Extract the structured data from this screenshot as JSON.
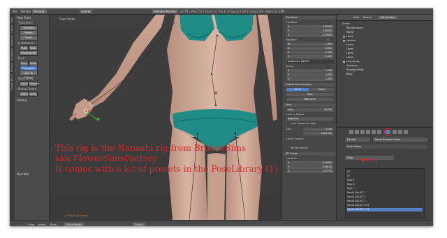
{
  "topbar": {
    "menu_items": [
      "File",
      "Render",
      "Window",
      "Help"
    ],
    "layout": "Default",
    "scene": "Scene",
    "engine": "Blender Render",
    "stats": "v2.78 | Verts:59 | Faces:0 | Tris:0 | Objects:1/42 | Lamps:0/0 | Mem:53.19M"
  },
  "left_tools": {
    "tabs": [
      "Tools",
      "Create",
      "Relations",
      "Animation",
      "Physics",
      "Grease Pencil"
    ],
    "section_pose_tools": "Pose Tools",
    "transform_label": "Transform:",
    "translate": "Translate",
    "rotate": "Rotate",
    "scale": "Scale",
    "in_between_label": "In-Between:",
    "push": "Push",
    "relax": "Relax",
    "breakdowner": "Breakdowner",
    "pose_label": "Pose:",
    "copy": "Copy",
    "paste": "Paste",
    "propagate": "Propagate",
    "add_to_library": "Add To Library",
    "keyframes_label": "Keyframes:",
    "insert": "Insert",
    "remove": "Remove",
    "motion_paths_label": "Motion Paths:",
    "calculate": "Calculate",
    "clear": "Clear",
    "history": "History",
    "operator": "Operator"
  },
  "viewport": {
    "label": "Front Ortho",
    "status": "(0) rig : b_R_Hand_"
  },
  "properties": {
    "transform_header": "Transform",
    "location_label": "Location:",
    "location": [
      {
        "k": "X:",
        "v": "0.00000"
      },
      {
        "k": "Y:",
        "v": "0.00000"
      },
      {
        "k": "Z:",
        "v": "0.00000"
      }
    ],
    "rotation_label": "Rotation:",
    "rotation_mode": "4L",
    "rotation": [
      {
        "k": "W:",
        "v": "1.000"
      },
      {
        "k": "X:",
        "v": "0.000"
      },
      {
        "k": "Y:",
        "v": "0.000"
      },
      {
        "k": "Z:",
        "v": "0.000"
      }
    ],
    "rotation_mode_select": "Quaternion (WXYZ)",
    "scale_label": "Scale:",
    "scale": [
      {
        "k": "X:",
        "v": "1.000"
      },
      {
        "k": "Y:",
        "v": "1.000"
      },
      {
        "k": "Z:",
        "v": "1.000"
      }
    ],
    "grease_pencil_header": "Grease Pencil Layers",
    "scene_btn": "Scene",
    "object_btn": "Object",
    "new_btn": "New",
    "new_layer_btn": "New Layer",
    "view_header": "View",
    "lens_label": "Lens:",
    "lens_value": "35.000",
    "lock_to_object": "Lock to Object:",
    "lock_field": "BodyOnly",
    "lock_camera_to_view": "Lock Camera to View",
    "clip_label": "Clip:",
    "clip_start": "0.100",
    "clip_end": "1000.000",
    "local_camera": "Local Camera:",
    "render_border": "Render Border",
    "cursor_header": "3D Cursor",
    "cursor_location_label": "Location:",
    "cursor": [
      {
        "k": "X:",
        "v": "-0.04850"
      },
      {
        "k": "Y:",
        "v": "0.06152"
      },
      {
        "k": "Z:",
        "v": "0.67713"
      }
    ]
  },
  "outliner": {
    "view": "View",
    "search": "Search",
    "all_scenes": "All Scenes",
    "rows": [
      "Scene",
      "RenderLayers",
      "World",
      "Lamp",
      "camera",
      "Lamp",
      "Lamp",
      "Lamp",
      "Lamp",
      "control_rig",
      "Armature",
      "Shadow_Mesh",
      "Body"
    ]
  },
  "right_props": {
    "armature_field": "Nanashi",
    "armature_zone": "Name Armature Zone",
    "pose_library_header": "Pose Library",
    "pose_lib_field": "Poses",
    "poses": [
      "00",
      "01",
      "Digit 5",
      "Digit 6",
      "Digit 7",
      "Hand1 BALLET 1",
      "Hand1 BALLET 2",
      "Hand2 BALLET 5",
      "Hand1 BALLET 6 V2",
      "Hand1 BALLET 5 V2"
    ]
  },
  "bottombar": {
    "view": "View",
    "select": "Select",
    "pose": "Pose",
    "mode": "Pose Mode",
    "pivot": "Local"
  },
  "annotation": {
    "line1": "This rig is the Nanashi rig from BrokenSims",
    "line2": "aka FlowerSimsFactory",
    "line3": "It comes with a lot of presets in the PoseLibrary (1)",
    "marker": "1"
  }
}
